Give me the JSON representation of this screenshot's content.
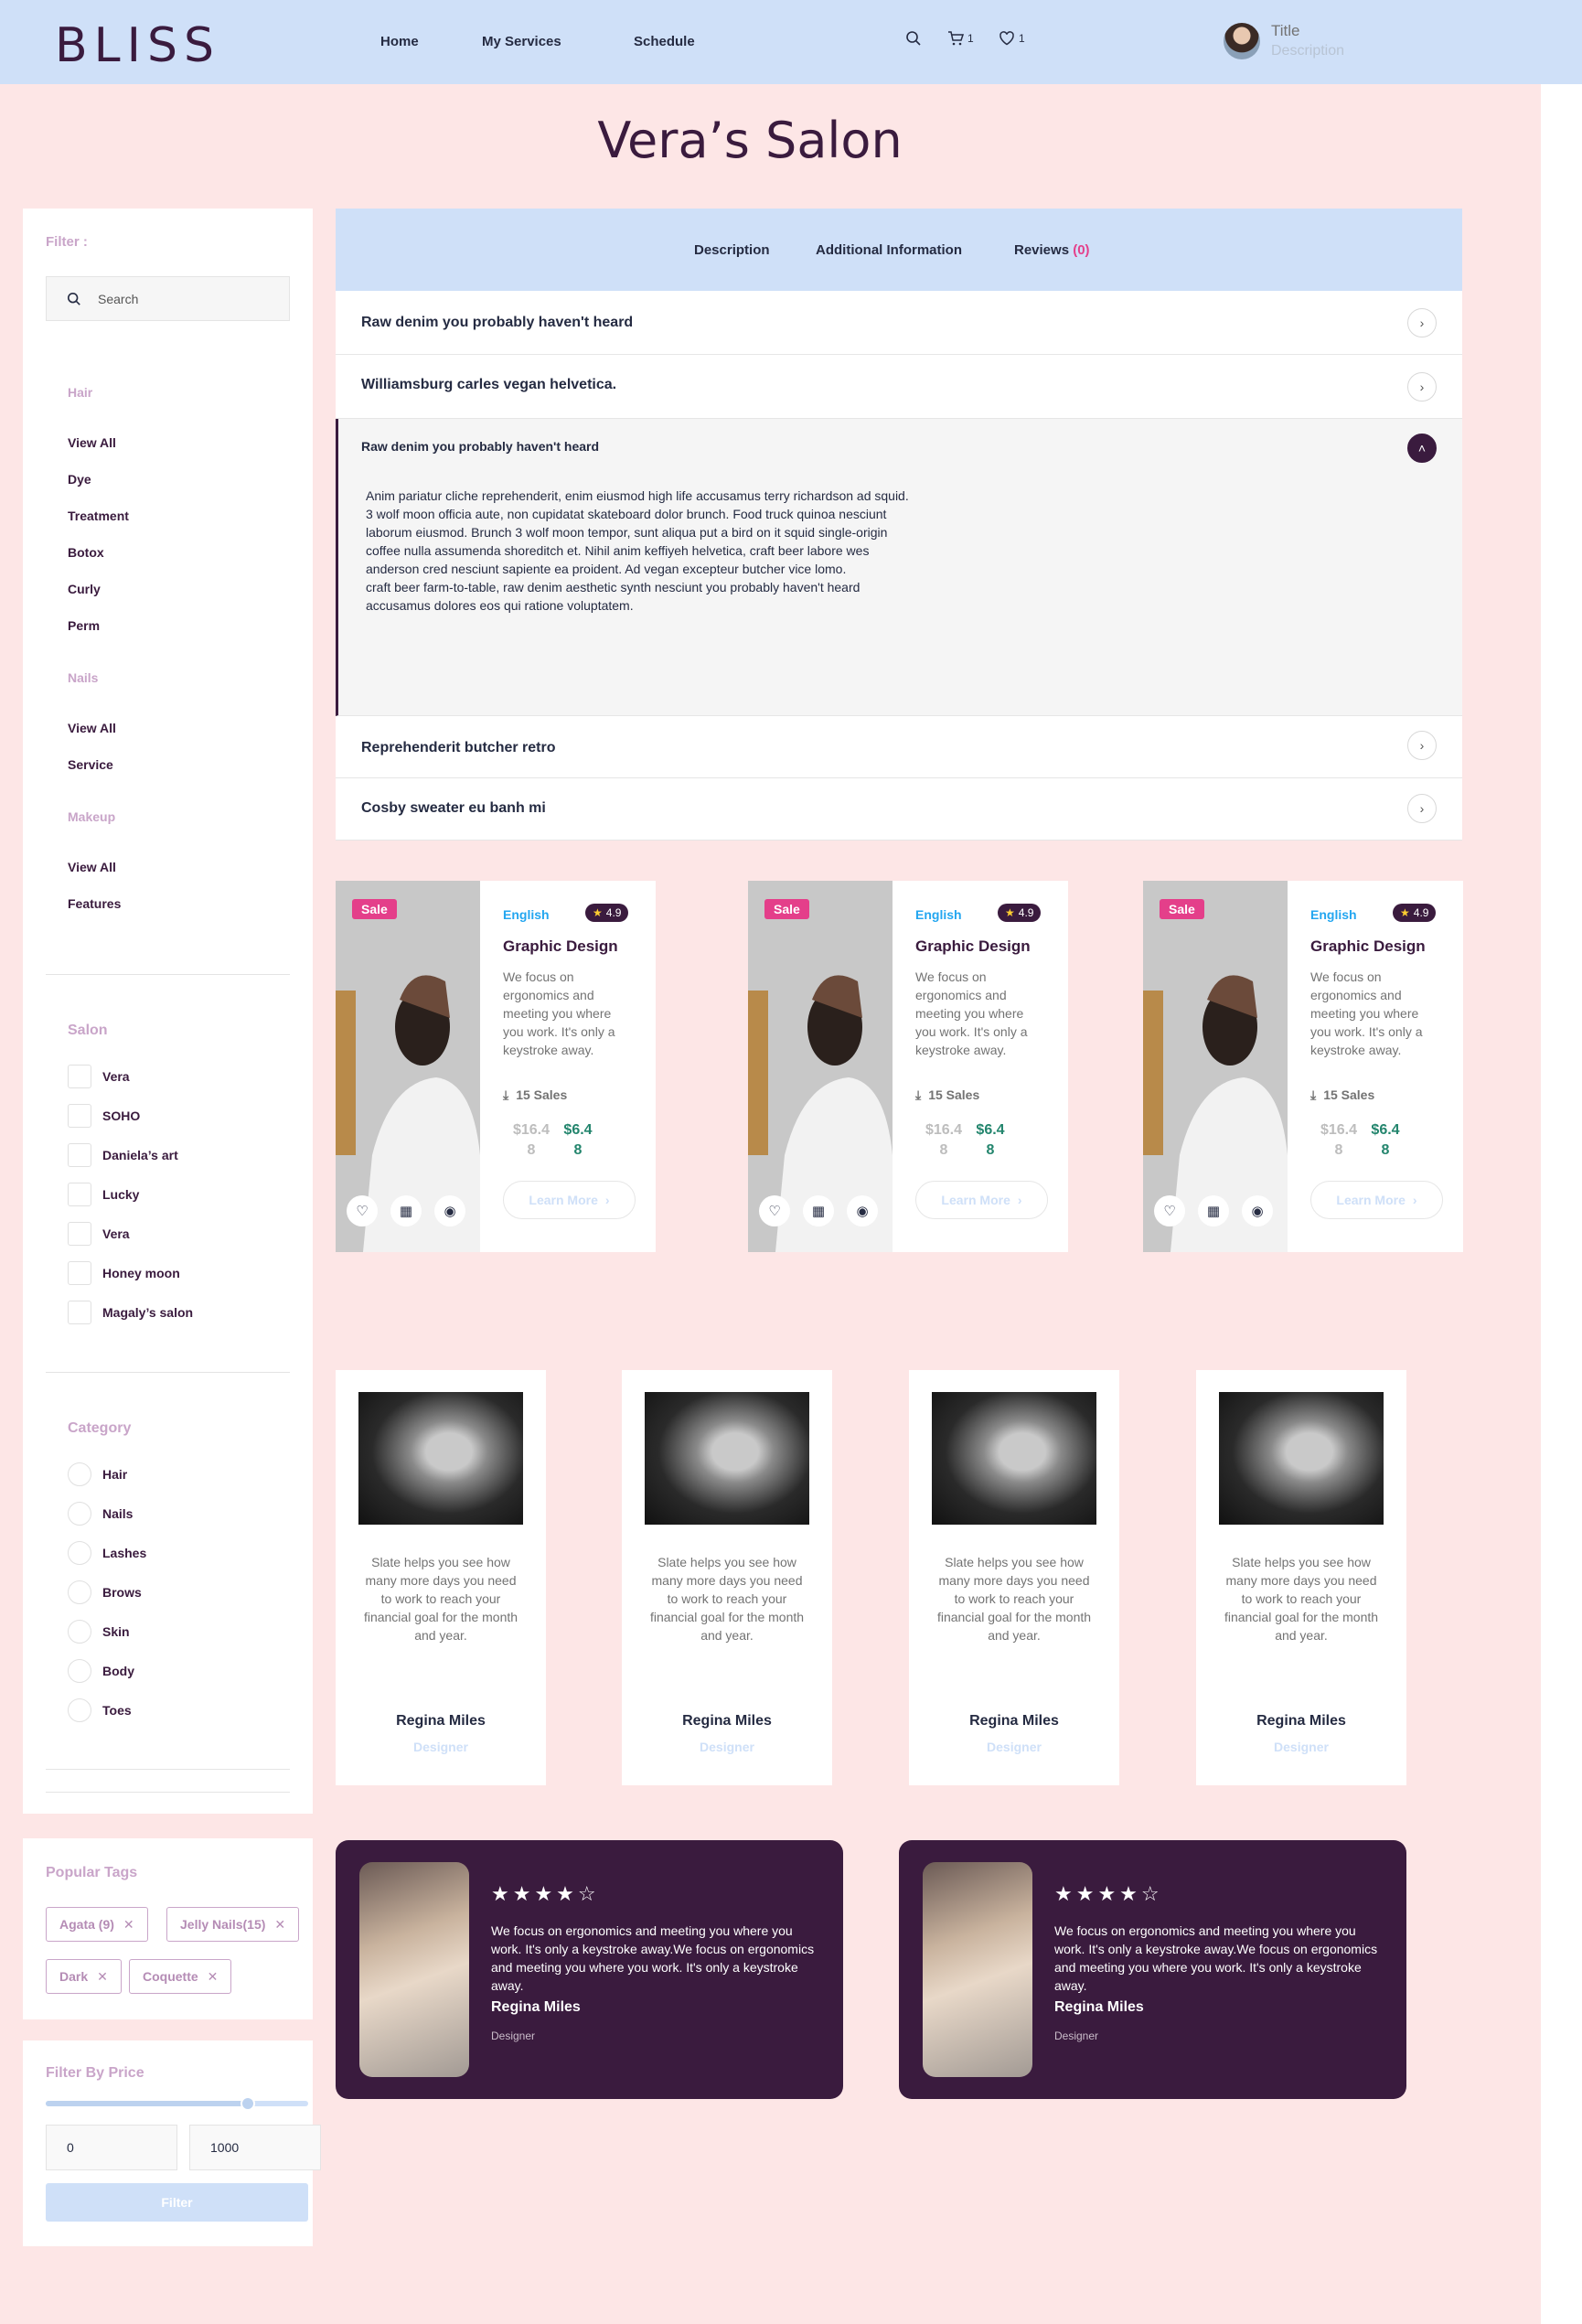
{
  "header": {
    "logo": "BLISS",
    "nav": [
      "Home",
      "My Services",
      "Schedule"
    ],
    "cart_count": "1",
    "wishlist_count": "1",
    "profile": {
      "title": "Title",
      "description": "Description"
    }
  },
  "page_title": "Vera’s Salon",
  "sidebar": {
    "filter_label": "Filter :",
    "search_placeholder": "Search",
    "hair": {
      "label": "Hair",
      "items": [
        "View All",
        "Dye",
        "Treatment",
        "Botox",
        "Curly",
        "Perm"
      ]
    },
    "nails": {
      "label": "Nails",
      "items": [
        "View All",
        "Service"
      ]
    },
    "makeup": {
      "label": "Makeup",
      "items": [
        "View All",
        "Features"
      ]
    },
    "salon": {
      "label": "Salon",
      "items": [
        "Vera",
        "SOHO",
        "Daniela’s art",
        "Lucky",
        "Vera",
        "Honey moon",
        "Magaly’s salon"
      ]
    },
    "category": {
      "label": "Category",
      "items": [
        "Hair",
        "Nails",
        "Lashes",
        "Brows",
        "Skin",
        "Body",
        "Toes"
      ]
    },
    "popular_tags": {
      "label": "Popular Tags",
      "tags": [
        "Agata (9)",
        "Jelly Nails(15)",
        "Dark",
        "Coquette"
      ]
    },
    "price": {
      "label": "Filter By Price",
      "min": "0",
      "max": "1000",
      "button": "Filter",
      "slider_fraction": 0.77
    }
  },
  "tabs": {
    "items": [
      "Description",
      "Additional Information",
      "Reviews"
    ],
    "reviews_count": "(0)"
  },
  "accordion": {
    "items": [
      "Raw denim you probably haven't heard",
      "Williamsburg carles vegan helvetica.",
      "Raw denim you probably haven't heard",
      "Reprehenderit butcher retro",
      "Cosby sweater eu banh mi"
    ],
    "open_body": "Anim pariatur cliche reprehenderit, enim eiusmod high life accusamus terry richardson ad squid.\n3 wolf moon officia aute, non cupidatat skateboard dolor brunch. Food truck quinoa nesciunt\n laborum eiusmod. Brunch 3 wolf moon tempor, sunt aliqua put a bird on it squid single-origin\ncoffee nulla assumenda shoreditch et. Nihil anim keffiyeh helvetica, craft beer labore wes\nanderson cred nesciunt sapiente ea proident. Ad vegan excepteur butcher vice lomo.\ncraft beer farm-to-table, raw denim aesthetic synth nesciunt you probably haven't heard\naccusamus dolores eos qui ratione voluptatem."
  },
  "products": [
    {
      "badge": "Sale",
      "language": "English",
      "rating": "4.9",
      "title": "Graphic Design",
      "description": "We focus on ergonomics and meeting you where you work. It's only a keystroke away.",
      "sales": "15 Sales",
      "old_price": "$16.48",
      "new_price": "$6.48",
      "button": "Learn More"
    },
    {
      "badge": "Sale",
      "language": "English",
      "rating": "4.9",
      "title": "Graphic Design",
      "description": "We focus on ergonomics and meeting you where you work. It's only a keystroke away.",
      "sales": "15 Sales",
      "old_price": "$16.48",
      "new_price": "$6.48",
      "button": "Learn More"
    },
    {
      "badge": "Sale",
      "language": "English",
      "rating": "4.9",
      "title": "Graphic Design",
      "description": "We focus on ergonomics and meeting you where you work. It's only a keystroke away.",
      "sales": "15 Sales",
      "old_price": "$16.48",
      "new_price": "$6.48",
      "button": "Learn More"
    }
  ],
  "team": [
    {
      "quote": "Slate helps you see how many more days you need to work to reach your financial goal for the month and year.",
      "name": "Regina Miles",
      "role": "Designer"
    },
    {
      "quote": "Slate helps you see how many more days you need to work to reach your financial goal for the month and year.",
      "name": "Regina Miles",
      "role": "Designer"
    },
    {
      "quote": "Slate helps you see how many more days you need to work to reach your financial goal for the month and year.",
      "name": "Regina Miles",
      "role": "Designer"
    },
    {
      "quote": "Slate helps you see how many more days you need to work to reach your financial goal for the month and year.",
      "name": "Regina Miles",
      "role": "Designer"
    }
  ],
  "testimonials": [
    {
      "stars": "★★★★☆",
      "rating": 4,
      "text": "We focus on ergonomics and meeting you where you work. It's only a keystroke away.We focus on ergonomics and meeting you where you work. It's only a keystroke away.",
      "name": "Regina Miles",
      "role": "Designer"
    },
    {
      "stars": "★★★★☆",
      "rating": 4,
      "text": "We focus on ergonomics and meeting you where you work. It's only a keystroke away.We focus on ergonomics and meeting you where you work. It's only a keystroke away.",
      "name": "Regina Miles",
      "role": "Designer"
    }
  ],
  "colors": {
    "primary": "#3a1b3e",
    "header_bg": "#cfe0f8",
    "page_bg": "#fde6e6",
    "accent_pink": "#e43f8a",
    "price_green": "#23856d",
    "link_blue": "#23a6f0"
  }
}
